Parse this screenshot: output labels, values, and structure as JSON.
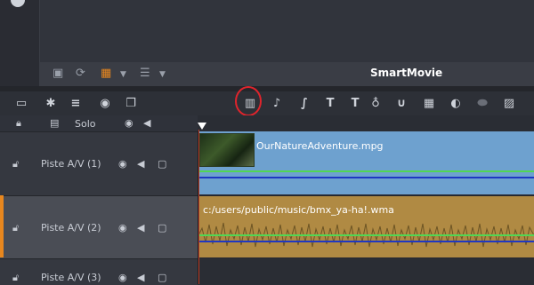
{
  "top_toolbar": {
    "brand": "SmartMovie"
  },
  "solo_label": "Solo",
  "tracks": [
    {
      "name": "Piste A/V (1)",
      "clip": "OurNatureAdventure.mpg"
    },
    {
      "name": "Piste A/V (2)",
      "clip": "c:/users/public/music/bmx_ya-ha!.wma"
    },
    {
      "name": "Piste A/V (3)"
    }
  ],
  "colors": {
    "accent": "#e8871e",
    "video_clip": "#6ea1cf",
    "audio_clip": "#b08a43",
    "highlight": "#e0242c"
  },
  "icons": {
    "main_toolbar": [
      "timeline-settings-icon",
      "gear-icon",
      "tracks-icon",
      "disc-icon",
      "copy-icon",
      "audio-mixer-icon",
      "music-note-icon",
      "scorepost-icon",
      "title-icon",
      "title-template-icon",
      "microphone-icon",
      "montage-icon",
      "grid-icon",
      "pan-icon",
      "track-icon",
      "image-icon"
    ]
  }
}
